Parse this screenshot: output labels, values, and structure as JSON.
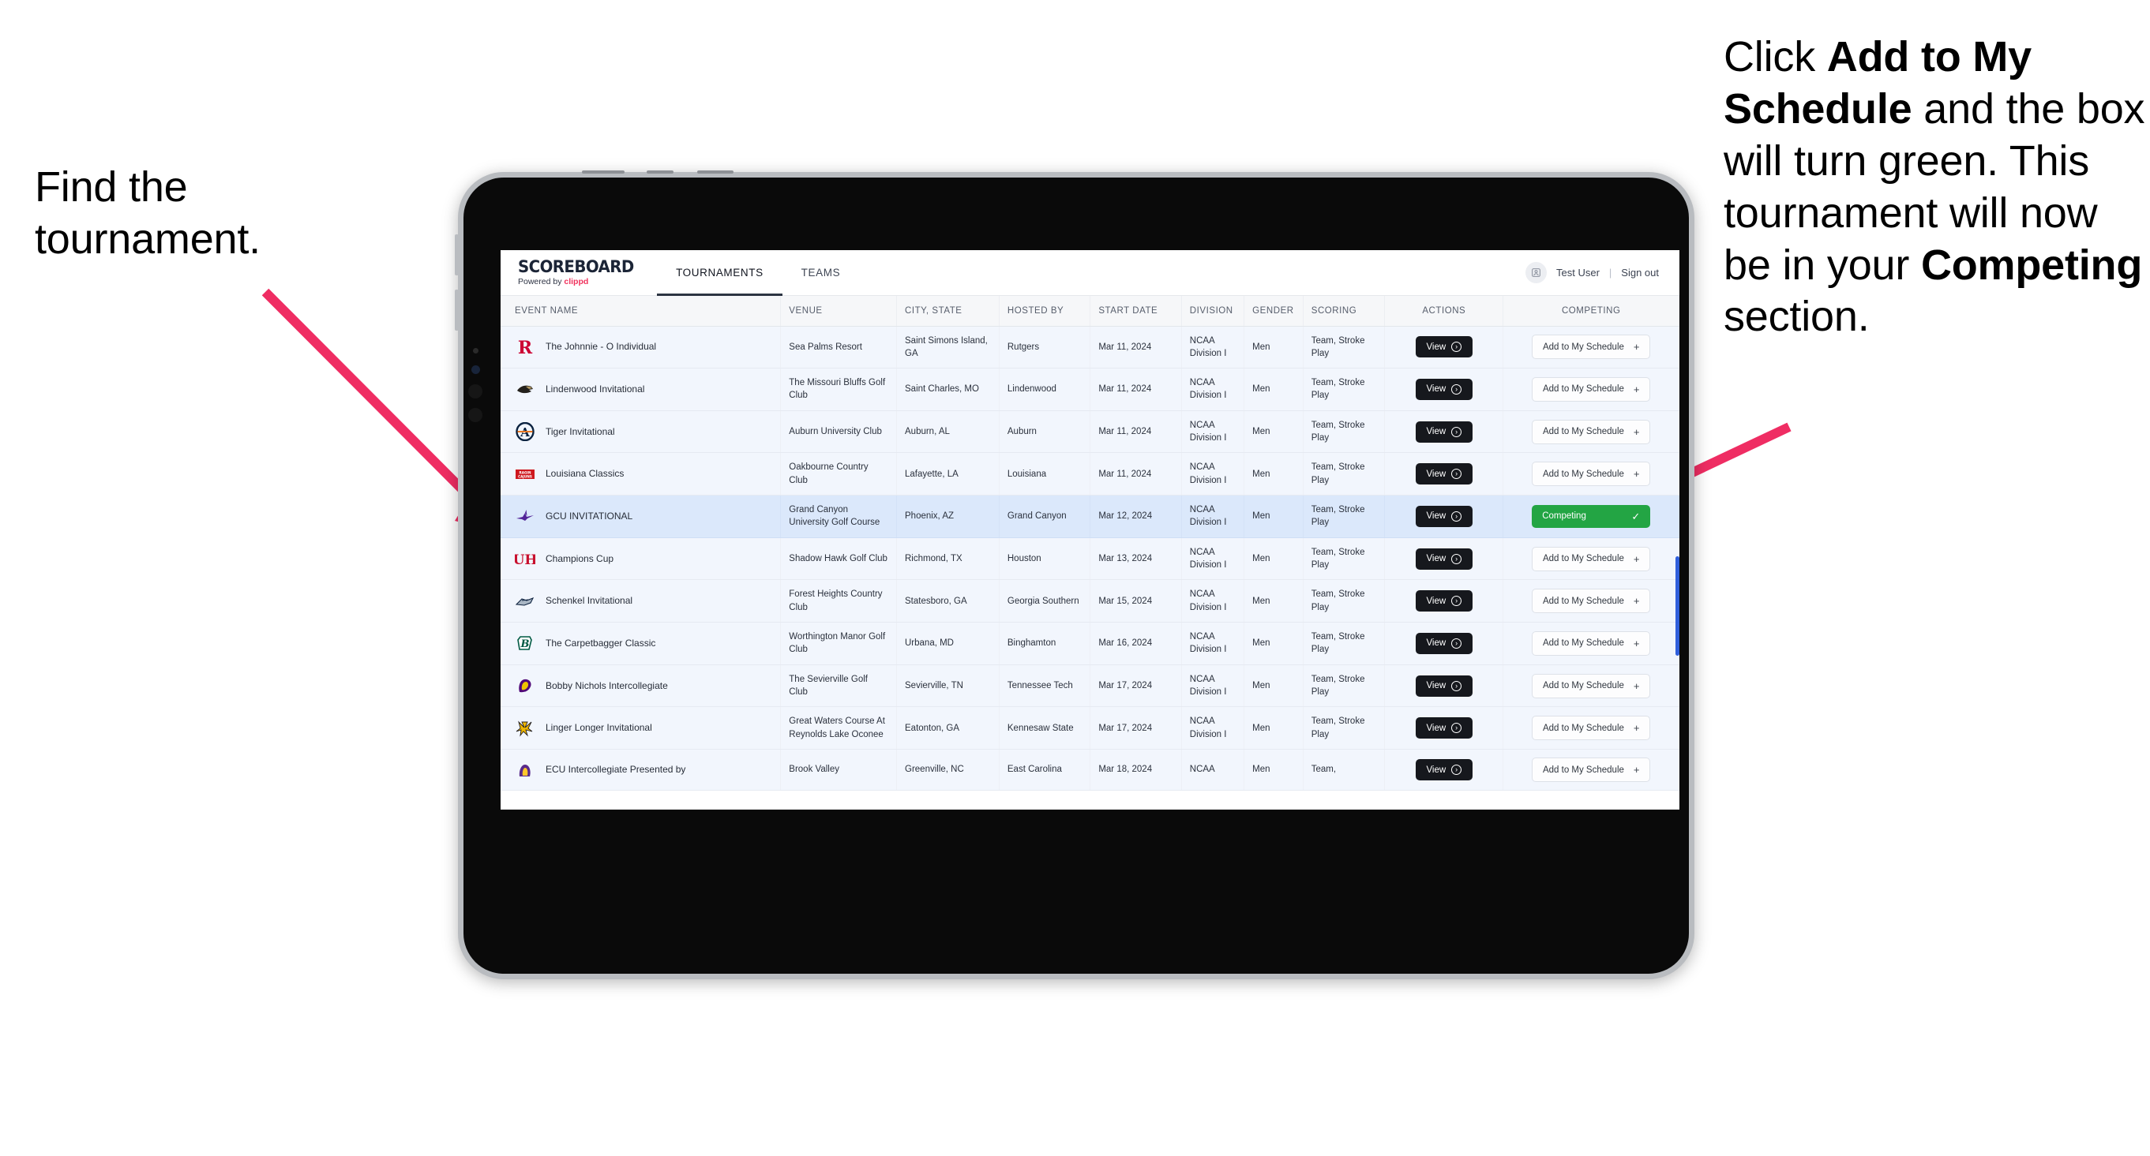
{
  "annotations": {
    "left": "Find the tournament.",
    "right_parts": [
      {
        "text": "Click ",
        "bold": false
      },
      {
        "text": "Add to My Schedule",
        "bold": true
      },
      {
        "text": " and the box will turn green. This tournament will now be in your ",
        "bold": false
      },
      {
        "text": "Competing",
        "bold": true
      },
      {
        "text": " section.",
        "bold": false
      }
    ],
    "right_plain": "Click Add to My Schedule and the box will turn green. This tournament will now be in your Competing section.",
    "arrow_color": "#ef2d63"
  },
  "app": {
    "brand": {
      "title": "SCOREBOARD",
      "sub_prefix": "Powered by ",
      "sub_brand": "clippd"
    },
    "tabs": [
      {
        "label": "TOURNAMENTS",
        "active": true
      },
      {
        "label": "TEAMS",
        "active": false
      }
    ],
    "user": {
      "name": "Test User",
      "separator": "|",
      "sign_out": "Sign out",
      "avatar_icon": "user-avatar-icon"
    }
  },
  "table": {
    "columns": [
      "EVENT NAME",
      "VENUE",
      "CITY, STATE",
      "HOSTED BY",
      "START DATE",
      "DIVISION",
      "GENDER",
      "SCORING",
      "ACTIONS",
      "COMPETING"
    ],
    "labels": {
      "view": "View",
      "add": "Add to My Schedule",
      "add_icon": "plus-icon",
      "competing": "Competing",
      "competing_icon": "check-icon",
      "view_icon": "arrow-right-circle-icon"
    },
    "colors": {
      "row": "#f2f6fd",
      "row_selected": "#dbe8fb",
      "competing_green": "#23a544",
      "view_black": "#16181d",
      "scrollbar_blue": "#1b4fd8"
    },
    "rows": [
      {
        "logo": "rutgers-logo",
        "event": "The Johnnie - O Individual",
        "venue": "Sea Palms Resort",
        "city": "Saint Simons Island, GA",
        "host": "Rutgers",
        "date": "Mar 11, 2024",
        "division": "NCAA Division I",
        "gender": "Men",
        "scoring": "Team, Stroke Play",
        "competing": false,
        "selected": false
      },
      {
        "logo": "lindenwood-logo",
        "event": "Lindenwood Invitational",
        "venue": "The Missouri Bluffs Golf Club",
        "city": "Saint Charles, MO",
        "host": "Lindenwood",
        "date": "Mar 11, 2024",
        "division": "NCAA Division I",
        "gender": "Men",
        "scoring": "Team, Stroke Play",
        "competing": false,
        "selected": false
      },
      {
        "logo": "auburn-logo",
        "event": "Tiger Invitational",
        "venue": "Auburn University Club",
        "city": "Auburn, AL",
        "host": "Auburn",
        "date": "Mar 11, 2024",
        "division": "NCAA Division I",
        "gender": "Men",
        "scoring": "Team, Stroke Play",
        "competing": false,
        "selected": false
      },
      {
        "logo": "louisiana-ragin-cajuns-logo",
        "event": "Louisiana Classics",
        "venue": "Oakbourne Country Club",
        "city": "Lafayette, LA",
        "host": "Louisiana",
        "date": "Mar 11, 2024",
        "division": "NCAA Division I",
        "gender": "Men",
        "scoring": "Team, Stroke Play",
        "competing": false,
        "selected": false
      },
      {
        "logo": "grand-canyon-logo",
        "event": "GCU INVITATIONAL",
        "venue": "Grand Canyon University Golf Course",
        "city": "Phoenix, AZ",
        "host": "Grand Canyon",
        "date": "Mar 12, 2024",
        "division": "NCAA Division I",
        "gender": "Men",
        "scoring": "Team, Stroke Play",
        "competing": true,
        "selected": true
      },
      {
        "logo": "houston-logo",
        "event": "Champions Cup",
        "venue": "Shadow Hawk Golf Club",
        "city": "Richmond, TX",
        "host": "Houston",
        "date": "Mar 13, 2024",
        "division": "NCAA Division I",
        "gender": "Men",
        "scoring": "Team, Stroke Play",
        "competing": false,
        "selected": false
      },
      {
        "logo": "georgia-southern-logo",
        "event": "Schenkel Invitational",
        "venue": "Forest Heights Country Club",
        "city": "Statesboro, GA",
        "host": "Georgia Southern",
        "date": "Mar 15, 2024",
        "division": "NCAA Division I",
        "gender": "Men",
        "scoring": "Team, Stroke Play",
        "competing": false,
        "selected": false
      },
      {
        "logo": "binghamton-logo",
        "event": "The Carpetbagger Classic",
        "venue": "Worthington Manor Golf Club",
        "city": "Urbana, MD",
        "host": "Binghamton",
        "date": "Mar 16, 2024",
        "division": "NCAA Division I",
        "gender": "Men",
        "scoring": "Team, Stroke Play",
        "competing": false,
        "selected": false
      },
      {
        "logo": "tennessee-tech-logo",
        "event": "Bobby Nichols Intercollegiate",
        "venue": "The Sevierville Golf Club",
        "city": "Sevierville, TN",
        "host": "Tennessee Tech",
        "date": "Mar 17, 2024",
        "division": "NCAA Division I",
        "gender": "Men",
        "scoring": "Team, Stroke Play",
        "competing": false,
        "selected": false
      },
      {
        "logo": "kennesaw-state-logo",
        "event": "Linger Longer Invitational",
        "venue": "Great Waters Course At Reynolds Lake Oconee",
        "city": "Eatonton, GA",
        "host": "Kennesaw State",
        "date": "Mar 17, 2024",
        "division": "NCAA Division I",
        "gender": "Men",
        "scoring": "Team, Stroke Play",
        "competing": false,
        "selected": false
      },
      {
        "logo": "ecu-logo",
        "event": "ECU Intercollegiate Presented by",
        "venue": "Brook Valley",
        "city": "Greenville, NC",
        "host": "East Carolina",
        "date": "Mar 18, 2024",
        "division": "NCAA",
        "gender": "Men",
        "scoring": "Team,",
        "competing": false,
        "selected": false,
        "clipped": true
      }
    ]
  }
}
